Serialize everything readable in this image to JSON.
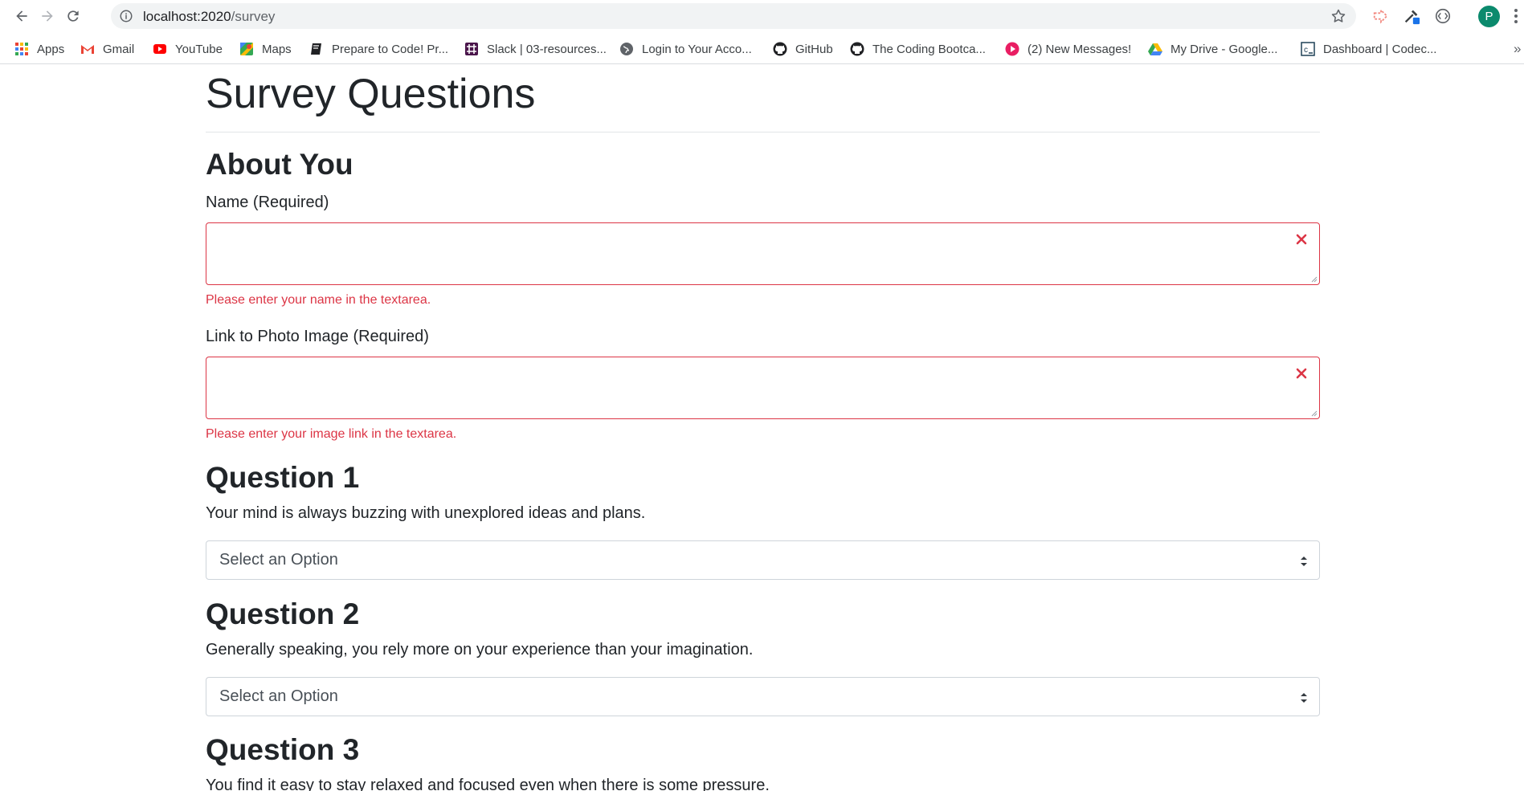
{
  "browser": {
    "url_host": "localhost:2020",
    "url_path": "/survey",
    "profile_initial": "P",
    "bookmarks": [
      {
        "label": "Apps",
        "icon": "apps-grid-icon"
      },
      {
        "label": "Gmail",
        "icon": "gmail-icon"
      },
      {
        "label": "YouTube",
        "icon": "youtube-icon"
      },
      {
        "label": "Maps",
        "icon": "maps-icon"
      },
      {
        "label": "Prepare to Code! Pr...",
        "icon": "book-icon"
      },
      {
        "label": "Slack | 03-resources...",
        "icon": "slack-icon"
      },
      {
        "label": "Login to Your Acco...",
        "icon": "globe-icon"
      },
      {
        "label": "GitHub",
        "icon": "github-icon"
      },
      {
        "label": "The Coding Bootca...",
        "icon": "github-icon"
      },
      {
        "label": "(2) New Messages!",
        "icon": "messages-icon"
      },
      {
        "label": "My Drive - Google...",
        "icon": "drive-icon"
      },
      {
        "label": "Dashboard | Codec...",
        "icon": "codecademy-icon"
      }
    ],
    "more_label": "»"
  },
  "page": {
    "title": "Survey Questions",
    "about": {
      "heading": "About You",
      "name_label": "Name (Required)",
      "name_error": "Please enter your name in the textarea.",
      "photo_label": "Link to Photo Image (Required)",
      "photo_error": "Please enter your image link in the textarea."
    },
    "questions": [
      {
        "heading": "Question 1",
        "text": "Your mind is always buzzing with unexplored ideas and plans.",
        "selected": "Select an Option"
      },
      {
        "heading": "Question 2",
        "text": "Generally speaking, you rely more on your experience than your imagination.",
        "selected": "Select an Option"
      },
      {
        "heading": "Question 3",
        "text": "You find it easy to stay relaxed and focused even when there is some pressure."
      }
    ]
  },
  "colors": {
    "error": "#dc3545",
    "profile": "#0b8a6d"
  }
}
